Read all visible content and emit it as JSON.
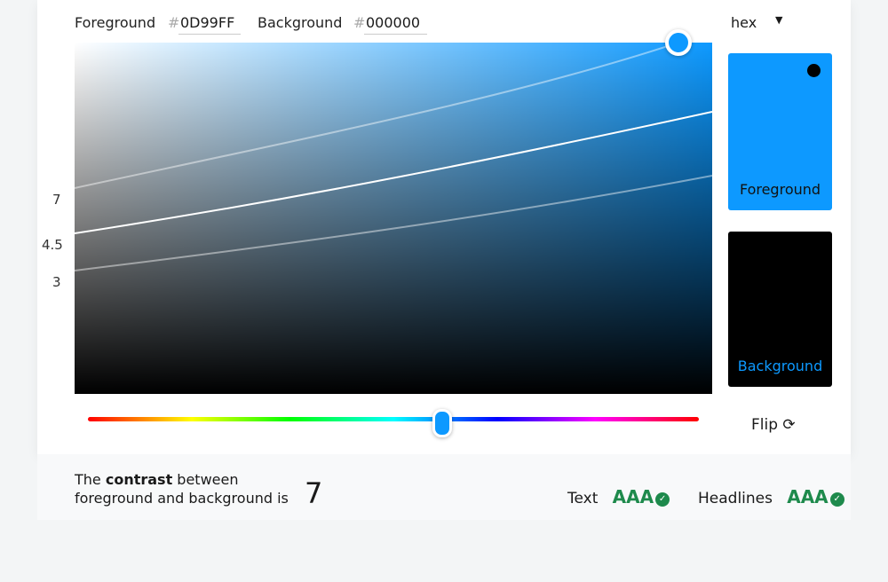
{
  "header": {
    "foreground_label": "Foreground",
    "foreground_value": "0D99FF",
    "background_label": "Background",
    "background_value": "000000",
    "hash": "#",
    "format": "hex"
  },
  "colors": {
    "foreground": "#0D99FF",
    "background": "#000000",
    "pass": "#1e8a4c"
  },
  "picker": {
    "contrast_ticks": [
      "7",
      "4.5",
      "3"
    ]
  },
  "swatches": {
    "foreground_label": "Foreground",
    "background_label": "Background"
  },
  "flip_label": "Flip",
  "summary": {
    "prefix": "The ",
    "bold": "contrast",
    "suffix": " between",
    "line2": "foreground and background is",
    "ratio": "7"
  },
  "ratings": [
    {
      "label": "Text",
      "level": "AAA"
    },
    {
      "label": "Headlines",
      "level": "AAA"
    }
  ]
}
